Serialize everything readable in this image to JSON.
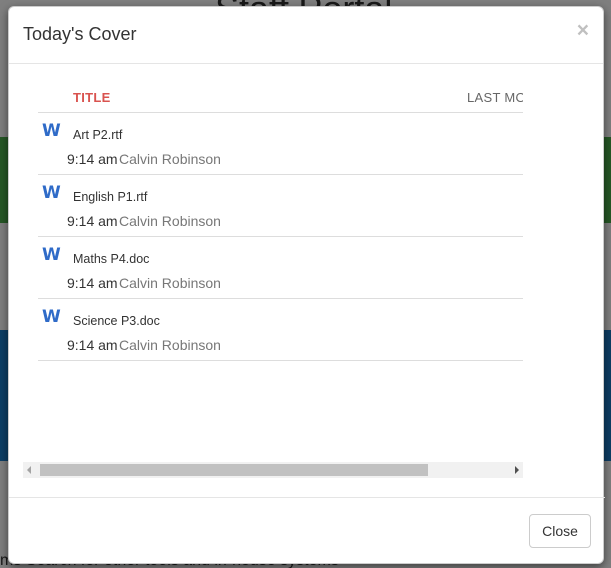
{
  "background": {
    "title": "Staff Portal",
    "bottom_text": "ms Search for other tools and in-house systems"
  },
  "modal": {
    "title": "Today's Cover",
    "close_symbol": "×",
    "columns": {
      "title": "TITLE",
      "last_modified": "LAST MO"
    },
    "files": [
      {
        "icon": "word-doc-icon",
        "name": "Art P2.rtf",
        "time": "9:14 am",
        "author": "Calvin Robinson"
      },
      {
        "icon": "word-doc-icon",
        "name": "English P1.rtf",
        "time": "9:14 am",
        "author": "Calvin Robinson"
      },
      {
        "icon": "word-doc-icon",
        "name": "Maths P4.doc",
        "time": "9:14 am",
        "author": "Calvin Robinson"
      },
      {
        "icon": "word-doc-icon",
        "name": "Science P3.doc",
        "time": "9:14 am",
        "author": "Calvin Robinson"
      }
    ],
    "footer": {
      "close_label": "Close"
    }
  },
  "colors": {
    "title_column": "#d9534f",
    "word_icon": "#2f6bc8",
    "author_text": "#777777"
  }
}
